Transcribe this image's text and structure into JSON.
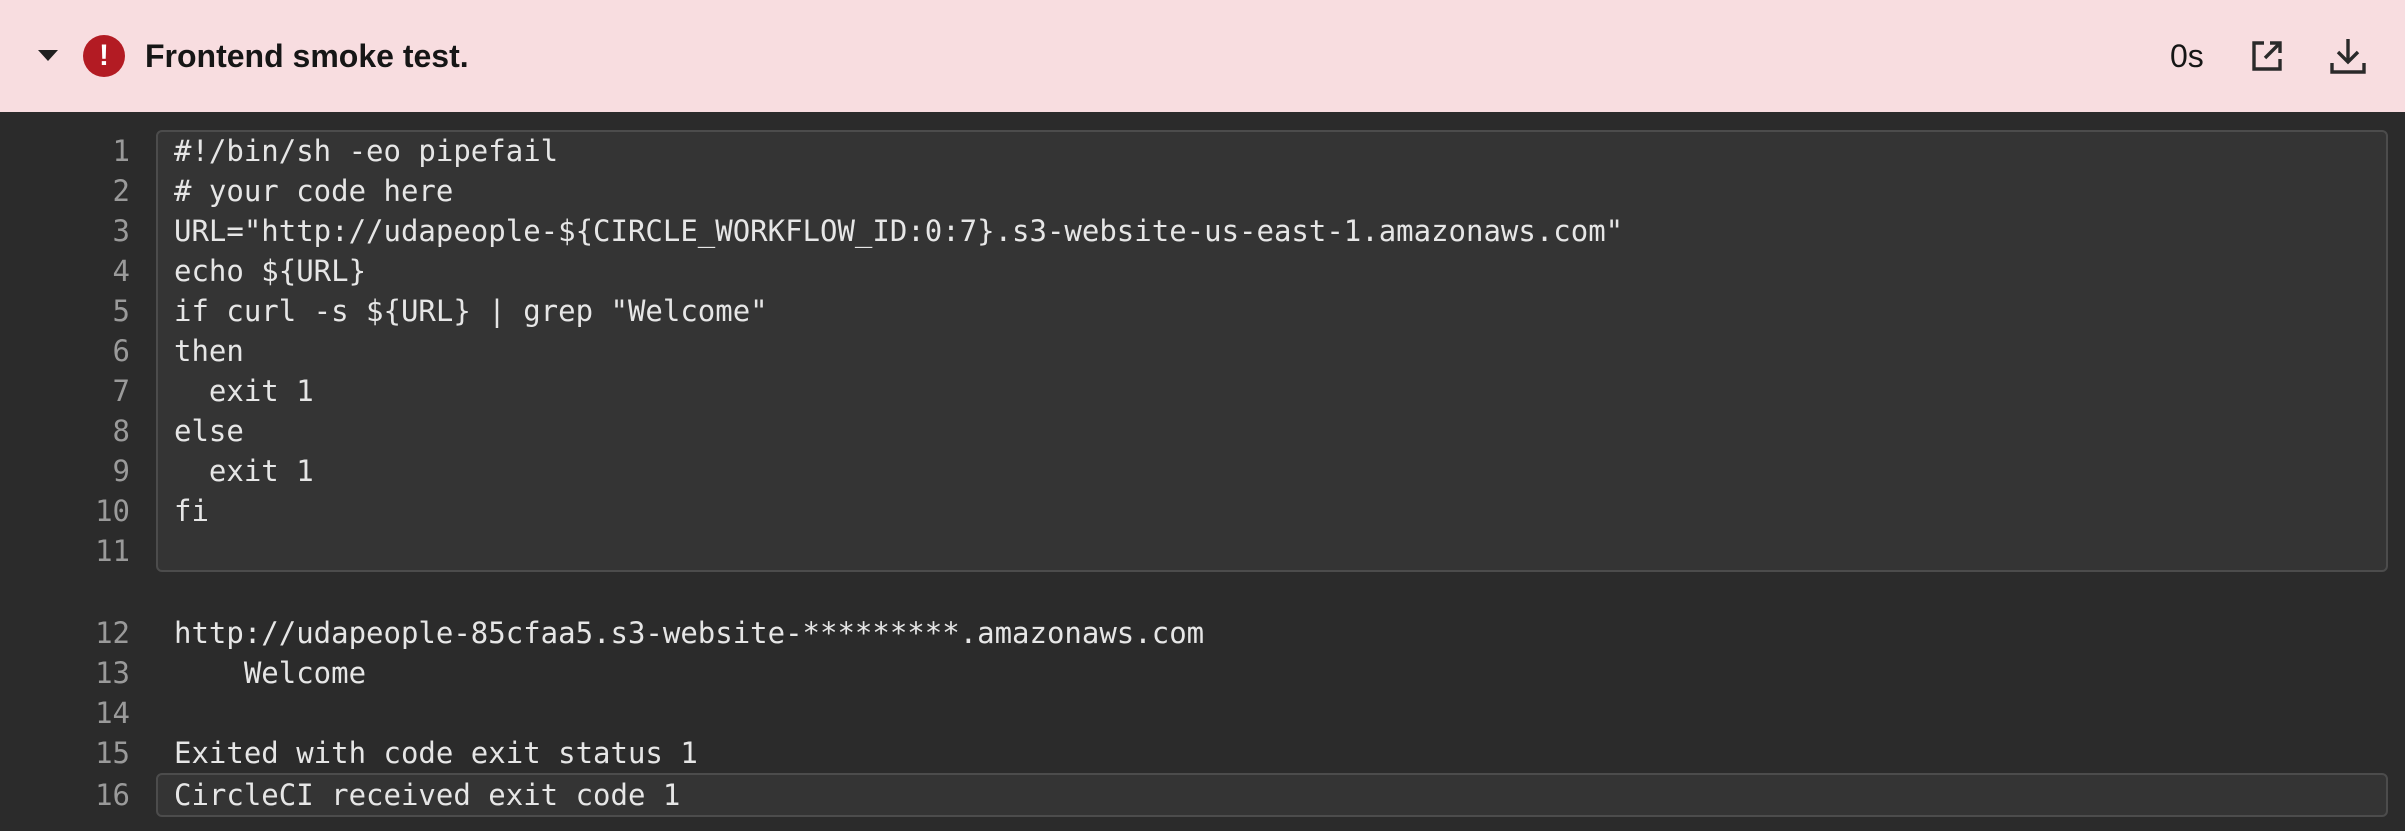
{
  "header": {
    "title": "Frontend smoke test.",
    "duration": "0s",
    "status_icon": "error-icon",
    "status_glyph": "!",
    "colors": {
      "background": "#f8dde0",
      "error": "#b31b23"
    }
  },
  "log": {
    "lines": [
      {
        "n": "1",
        "text": "#!/bin/sh -eo pipefail"
      },
      {
        "n": "2",
        "text": "# your code here"
      },
      {
        "n": "3",
        "text": "URL=\"http://udapeople-${CIRCLE_WORKFLOW_ID:0:7}.s3-website-us-east-1.amazonaws.com\""
      },
      {
        "n": "4",
        "text": "echo ${URL}"
      },
      {
        "n": "5",
        "text": "if curl -s ${URL} | grep \"Welcome\""
      },
      {
        "n": "6",
        "text": "then"
      },
      {
        "n": "7",
        "text": "  exit 1"
      },
      {
        "n": "8",
        "text": "else"
      },
      {
        "n": "9",
        "text": "  exit 1"
      },
      {
        "n": "10",
        "text": "fi"
      },
      {
        "n": "11",
        "text": ""
      },
      {
        "n": "12",
        "text": "http://udapeople-85cfaa5.s3-website-*********.amazonaws.com"
      },
      {
        "n": "13",
        "text": "    Welcome"
      },
      {
        "n": "14",
        "text": ""
      },
      {
        "n": "15",
        "text": "Exited with code exit status 1"
      },
      {
        "n": "16",
        "text": "CircleCI received exit code 1"
      }
    ]
  }
}
